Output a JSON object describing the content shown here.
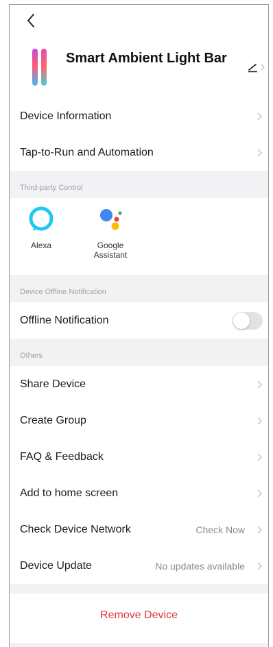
{
  "header": {
    "device_name": "Smart Ambient Light Bar"
  },
  "menu_top": {
    "device_information": "Device Information",
    "tap_to_run": "Tap-to-Run and Automation"
  },
  "third_party": {
    "header": "Third-party Control",
    "alexa_label": "Alexa",
    "google_label_line1": "Google",
    "google_label_line2": "Assistant"
  },
  "offline": {
    "header": "Device Offline Notification",
    "label": "Offline Notification",
    "enabled": false
  },
  "others": {
    "header": "Others",
    "share_device": "Share Device",
    "create_group": "Create Group",
    "faq_feedback": "FAQ & Feedback",
    "add_home_screen": "Add to home screen",
    "check_network": "Check Device Network",
    "check_network_value": "Check Now",
    "device_update": "Device Update",
    "device_update_value": "No updates available"
  },
  "footer": {
    "remove_device": "Remove Device"
  },
  "colors": {
    "accent_red": "#e0353a",
    "background": "#f2f2f4",
    "alexa_blue": "#1ec8f2"
  }
}
